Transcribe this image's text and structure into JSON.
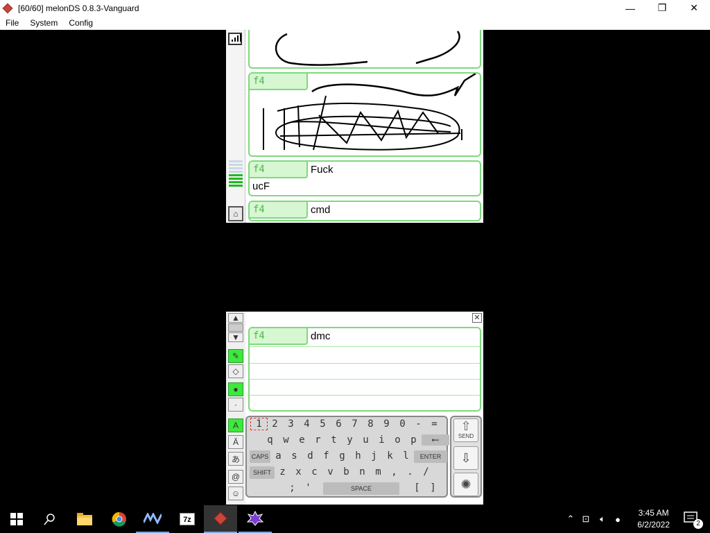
{
  "window": {
    "title": "[60/60] melonDS 0.8.3-Vanguard",
    "controls": [
      "—",
      "❐",
      "✕"
    ]
  },
  "menu": [
    "File",
    "System",
    "Config"
  ],
  "top_screen": {
    "messages": [
      {
        "tag": "f4",
        "type": "drawing"
      },
      {
        "tag": "f4",
        "type": "drawing"
      },
      {
        "tag": "f4",
        "text": "Fuck",
        "line2": "ucF"
      },
      {
        "tag": "f4",
        "text": "cmd"
      }
    ]
  },
  "bottom_screen": {
    "compose": {
      "tag": "f4",
      "text": "dmc"
    },
    "keyboard": {
      "row1": [
        "1",
        "2",
        "3",
        "4",
        "5",
        "6",
        "7",
        "8",
        "9",
        "0",
        "-",
        "="
      ],
      "row2": [
        "q",
        "w",
        "e",
        "r",
        "t",
        "y",
        "u",
        "i",
        "o",
        "p"
      ],
      "row3": [
        "a",
        "s",
        "d",
        "f",
        "g",
        "h",
        "j",
        "k",
        "l"
      ],
      "row4": [
        "z",
        "x",
        "c",
        "v",
        "b",
        "n",
        "m",
        ",",
        ".",
        "/"
      ],
      "row5": [
        ";",
        "'",
        "[",
        "]"
      ],
      "caps_label": "CAPS",
      "shift_label": "SHIFT",
      "enter_label": "ENTER",
      "space_label": "SPACE"
    },
    "actions": {
      "send_label": "SEND"
    }
  },
  "taskbar": {
    "clock_time": "3:45 AM",
    "clock_date": "6/2/2022",
    "notification_count": "2",
    "apps": [
      "start",
      "search",
      "file-explorer",
      "chrome",
      "app-va",
      "7zip",
      "melonds",
      "bizhawk"
    ]
  }
}
